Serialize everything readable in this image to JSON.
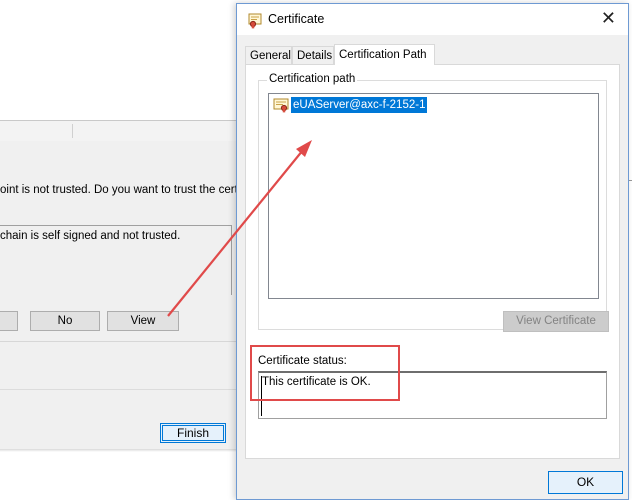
{
  "background_wizard": {
    "trust_prompt": "oint is not trusted. Do you want to trust the certificate",
    "chain_note": "chain is self signed and not trusted.",
    "buttons": {
      "no": "No",
      "view": "View",
      "finish": "Finish"
    }
  },
  "certificate_dialog": {
    "title": "Certificate",
    "close": "✕",
    "tabs": [
      {
        "label": "General",
        "active": false
      },
      {
        "label": "Details",
        "active": false
      },
      {
        "label": "Certification Path",
        "active": true
      }
    ],
    "certification_path": {
      "group_label": "Certification path",
      "items": [
        {
          "label": "eUAServer@axc-f-2152-1",
          "selected": true,
          "icon": "certificate-icon"
        }
      ],
      "view_certificate_button": "View Certificate"
    },
    "status": {
      "label": "Certificate status:",
      "text": "This certificate is OK."
    },
    "ok_button": "OK"
  },
  "annotations": {
    "color": "#e04a4a"
  },
  "colors": {
    "selection": "#0078d7",
    "dialog_border": "#6e9ad3"
  }
}
